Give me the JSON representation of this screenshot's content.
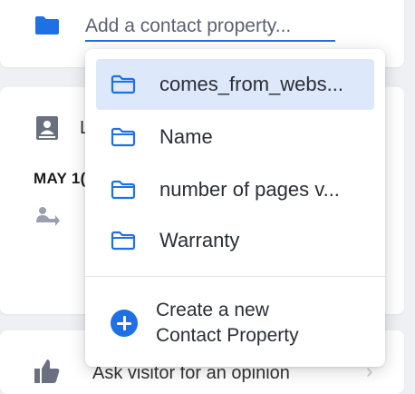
{
  "search": {
    "placeholder": "Add a contact property..."
  },
  "background": {
    "title_partial": "L",
    "date_partial": "MAY 1(",
    "bottom_text": "Ask visitor for an opinion"
  },
  "dropdown": {
    "items": [
      {
        "label": "comes_from_webs...",
        "selected": true,
        "icon": "folder-outline-icon"
      },
      {
        "label": "Name",
        "selected": false,
        "icon": "folder-outline-icon"
      },
      {
        "label": "number of pages v...",
        "selected": false,
        "icon": "folder-outline-icon"
      },
      {
        "label": "Warranty",
        "selected": false,
        "icon": "folder-outline-icon"
      }
    ],
    "create_label": "Create a new Contact Property",
    "create_icon": "plus-circle-icon"
  },
  "colors": {
    "accent": "#1f6fe5",
    "selected_bg": "#dde8fa",
    "page_bg": "#eef0f4",
    "icon_gray": "#6b7080"
  }
}
